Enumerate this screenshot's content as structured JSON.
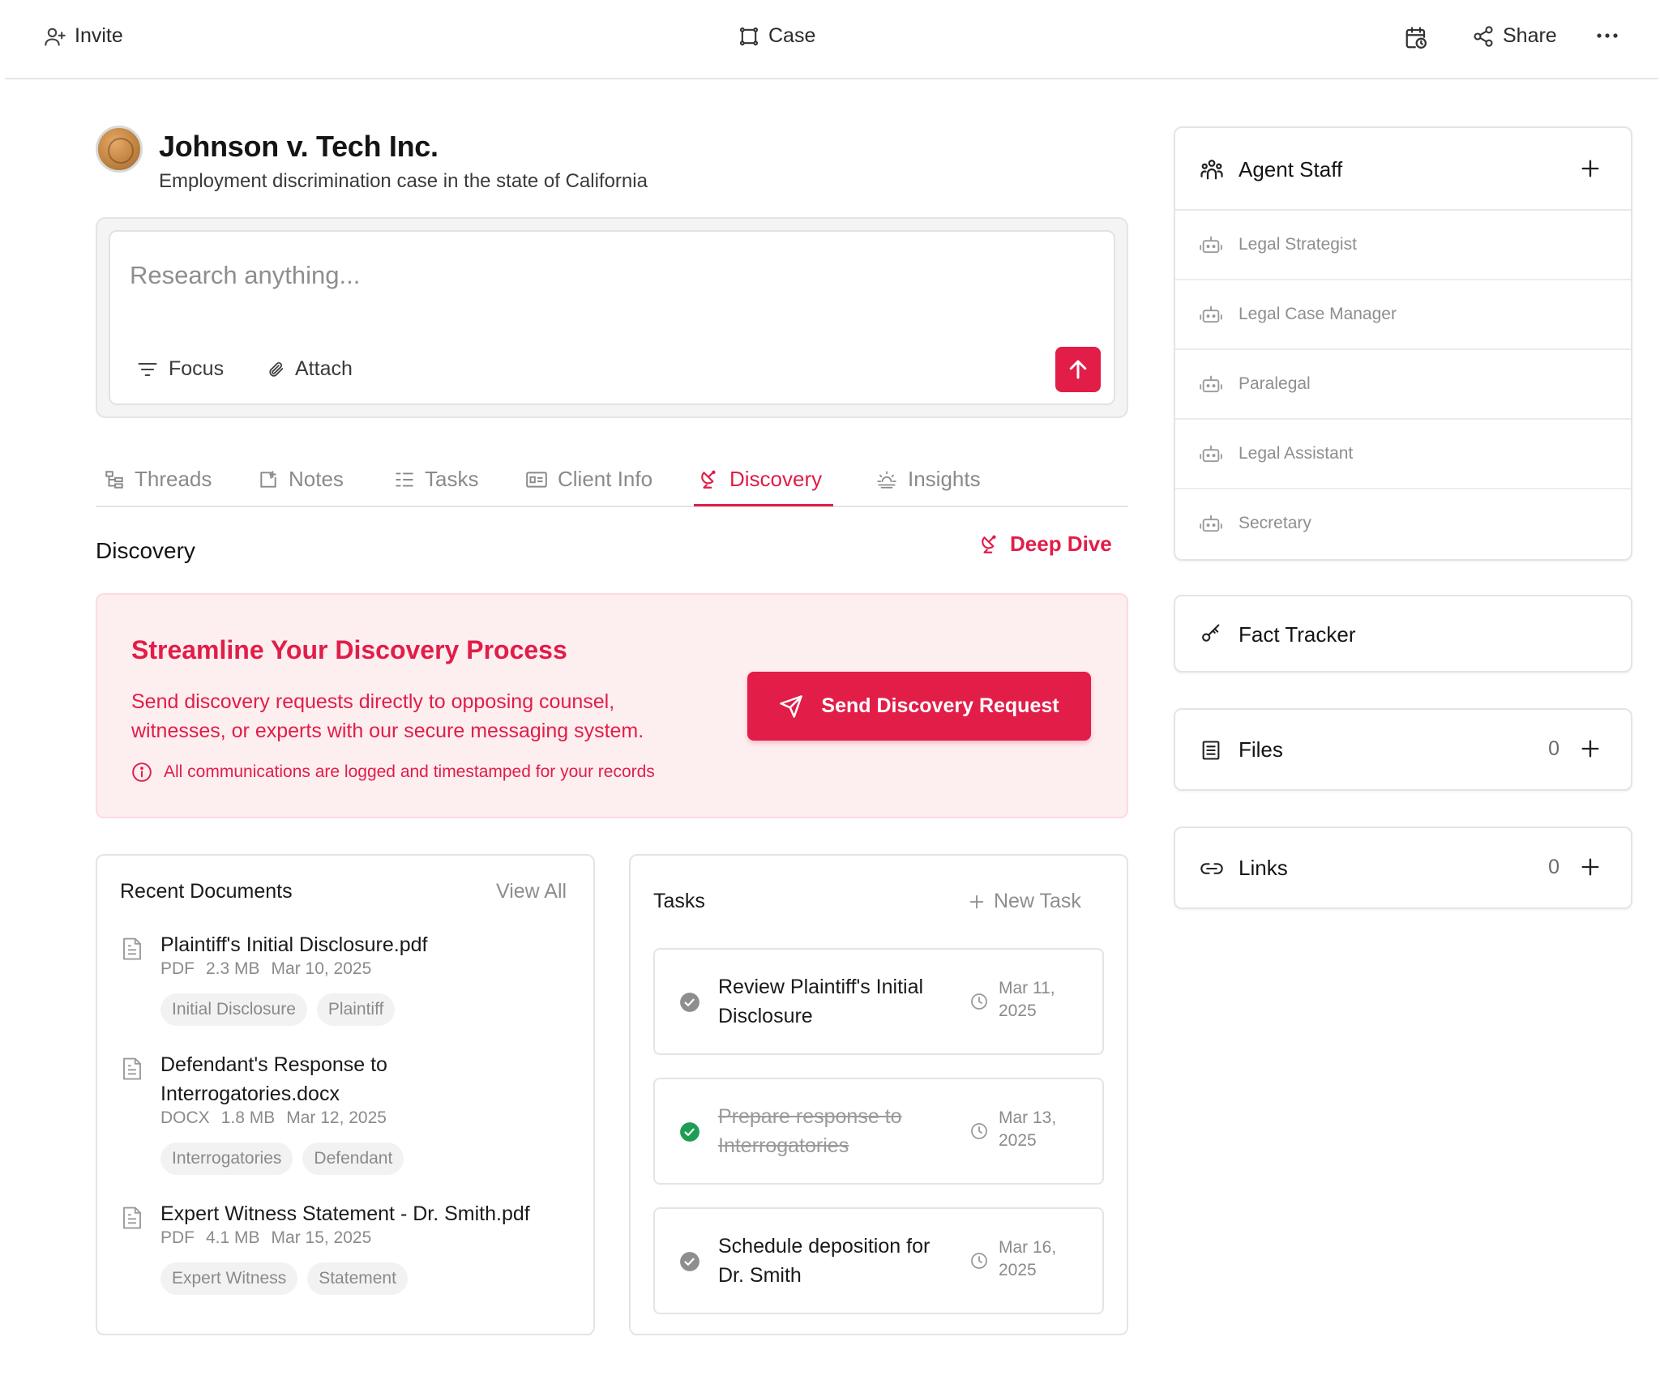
{
  "topbar": {
    "invite_label": "Invite",
    "case_label": "Case",
    "share_label": "Share"
  },
  "case": {
    "title": "Johnson v. Tech Inc.",
    "subtitle": "Employment discrimination case in the state of California"
  },
  "search": {
    "placeholder": "Research anything...",
    "focus_label": "Focus",
    "attach_label": "Attach"
  },
  "tabs": [
    {
      "label": "Threads",
      "icon": "threads-icon"
    },
    {
      "label": "Notes",
      "icon": "notes-icon"
    },
    {
      "label": "Tasks",
      "icon": "tasks-icon"
    },
    {
      "label": "Client Info",
      "icon": "client-info-icon"
    },
    {
      "label": "Discovery",
      "icon": "discovery-icon",
      "active": true
    },
    {
      "label": "Insights",
      "icon": "insights-icon"
    }
  ],
  "discovery": {
    "section_title": "Discovery",
    "deep_dive_label": "Deep Dive",
    "banner": {
      "title": "Streamline Your Discovery Process",
      "text": "Send discovery requests directly to opposing counsel, witnesses, or experts with our secure messaging system.",
      "note": "All communications are logged and timestamped for your records",
      "button_label": "Send Discovery Request"
    }
  },
  "documents": {
    "title": "Recent Documents",
    "view_all_label": "View All",
    "items": [
      {
        "name": "Plaintiff's Initial Disclosure.pdf",
        "type": "PDF",
        "size": "2.3 MB",
        "date": "Mar 10, 2025",
        "tags": [
          "Initial Disclosure",
          "Plaintiff"
        ]
      },
      {
        "name": "Defendant's Response to Interrogatories.docx",
        "type": "DOCX",
        "size": "1.8 MB",
        "date": "Mar 12, 2025",
        "tags": [
          "Interrogatories",
          "Defendant"
        ]
      },
      {
        "name": "Expert Witness Statement - Dr. Smith.pdf",
        "type": "PDF",
        "size": "4.1 MB",
        "date": "Mar 15, 2025",
        "tags": [
          "Expert Witness",
          "Statement"
        ]
      }
    ]
  },
  "tasks": {
    "title": "Tasks",
    "new_task_label": "New Task",
    "items": [
      {
        "title": "Review Plaintiff's Initial Disclosure",
        "date": "Mar 11, 2025",
        "done": false
      },
      {
        "title": "Prepare response to Interrogatories",
        "date": "Mar 13, 2025",
        "done": true
      },
      {
        "title": "Schedule deposition for Dr. Smith",
        "date": "Mar 16, 2025",
        "done": false
      }
    ]
  },
  "sidebar": {
    "agent_staff": {
      "title": "Agent Staff",
      "agents": [
        "Legal Strategist",
        "Legal Case Manager",
        "Paralegal",
        "Legal Assistant",
        "Secretary"
      ]
    },
    "fact_tracker": {
      "title": "Fact Tracker"
    },
    "files": {
      "title": "Files",
      "count": "0"
    },
    "links": {
      "title": "Links",
      "count": "0"
    }
  },
  "colors": {
    "accent": "#e11d48",
    "banner_bg": "#fdeef0",
    "done_check": "#1f9d55",
    "pending_check": "#8e8e8e"
  }
}
